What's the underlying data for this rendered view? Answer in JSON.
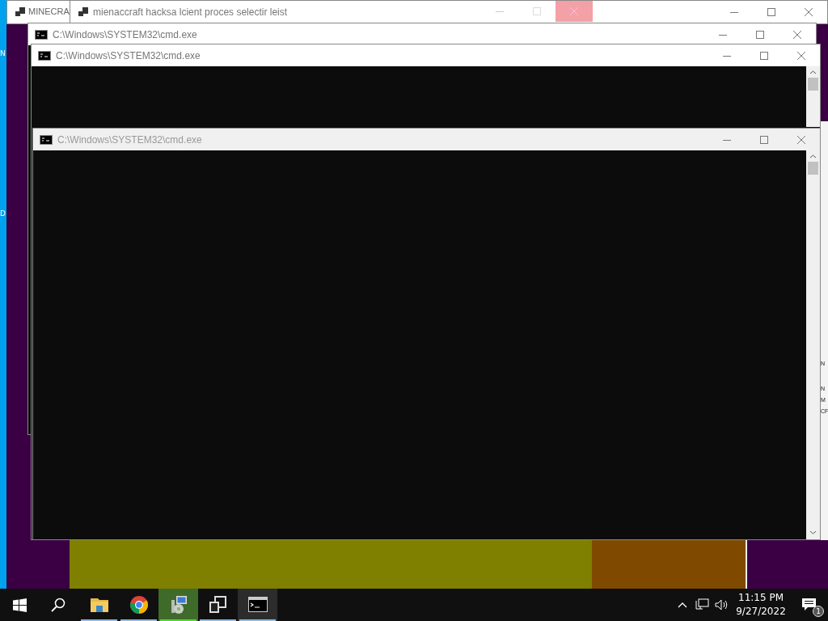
{
  "left_edge_texts": [
    "N",
    "D"
  ],
  "right_edge_texts": [
    "N",
    "N",
    "M",
    "CF"
  ],
  "windows": [
    {
      "title": "MINECRA",
      "kind": "app"
    },
    {
      "title": "mienaccraft hacksa lcient proces selectir leist",
      "kind": "app"
    },
    {
      "title": "C:\\Windows\\SYSTEM32\\cmd.exe",
      "kind": "console"
    },
    {
      "title": "C:\\Windows\\SYSTEM32\\cmd.exe",
      "kind": "console"
    },
    {
      "title": "C:\\Windows\\SYSTEM32\\cmd.exe",
      "kind": "console"
    }
  ],
  "taskbar": {
    "apps": [
      {
        "kind": "folder",
        "running": true,
        "selected": false
      },
      {
        "kind": "chrome",
        "running": true,
        "selected": false
      },
      {
        "kind": "installer",
        "running": true,
        "selected": true
      },
      {
        "kind": "windows",
        "running": true,
        "selected": false
      },
      {
        "kind": "console",
        "running": true,
        "selected": true
      }
    ],
    "time": "11:15 PM",
    "date": "9/27/2022",
    "notification_count": "1"
  }
}
